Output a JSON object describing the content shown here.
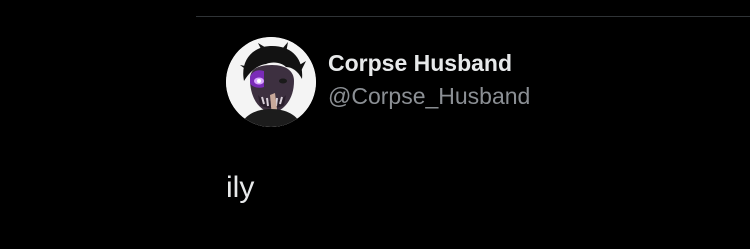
{
  "tweet": {
    "author": {
      "display_name": "Corpse Husband",
      "handle": "@Corpse_Husband",
      "avatar": "avatar-illustration-purple-masked-figure"
    },
    "text": "ily"
  },
  "colors": {
    "background": "#000000",
    "primary_text": "#e7e9ea",
    "secondary_text": "#8b8f94",
    "divider": "#2f3336",
    "avatar_accent": "#9b3dd6"
  }
}
